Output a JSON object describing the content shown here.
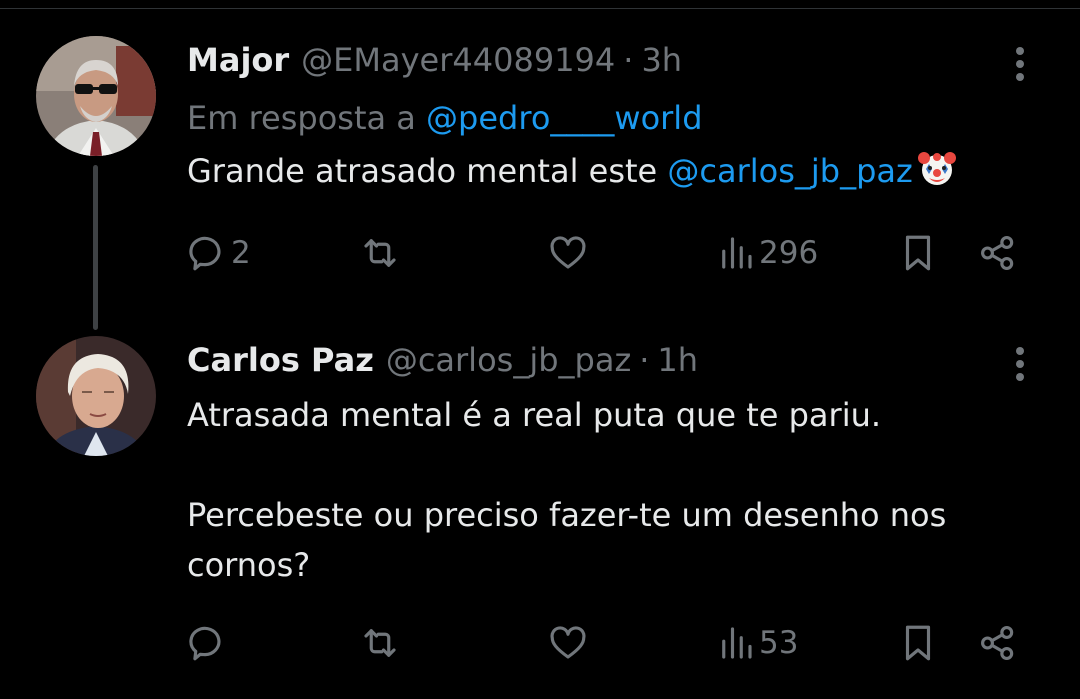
{
  "tweets": [
    {
      "author_name": "Major",
      "handle": "@EMayer44089194",
      "separator": "·",
      "time": "3h",
      "reply_prefix": "Em resposta a",
      "reply_handle": "@pedro____world",
      "text_before": "Grande atrasado mental este",
      "text_mention": "@carlos_jb_paz",
      "emoji_icon": "clown-face-emoji",
      "actions": {
        "replies": "2",
        "retweets": "",
        "likes": "",
        "views": "296"
      }
    },
    {
      "author_name": "Carlos Paz",
      "handle": "@carlos_jb_paz",
      "separator": "·",
      "time": "1h",
      "text": "Atrasada mental é a real puta que te pariu.\n\nPercebeste ou preciso fazer-te um desenho nos cornos?",
      "actions": {
        "replies": "",
        "retweets": "",
        "likes": "",
        "views": "53"
      }
    }
  ],
  "colors": {
    "background": "#000000",
    "text": "#e7e9ea",
    "secondary": "#71767b",
    "link": "#1d9bf0"
  }
}
